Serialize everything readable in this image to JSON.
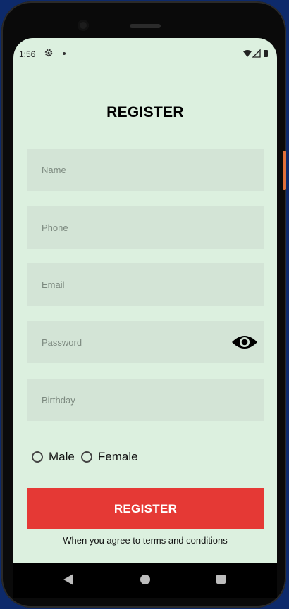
{
  "status_bar": {
    "time": "1:56",
    "icons": [
      "gear-icon",
      "notification-dot-icon",
      "wifi-icon",
      "signal-icon",
      "battery-icon"
    ]
  },
  "form": {
    "title": "REGISTER",
    "fields": [
      {
        "placeholder": "Name",
        "value": ""
      },
      {
        "placeholder": "Phone",
        "value": ""
      },
      {
        "placeholder": "Email",
        "value": ""
      },
      {
        "placeholder": "Password",
        "value": ""
      },
      {
        "placeholder": "Birthday",
        "value": ""
      }
    ],
    "gender_options": [
      "Male",
      "Female"
    ],
    "submit_label": "REGISTER",
    "terms_text": "When you agree to terms and conditions"
  },
  "nav_bar": {
    "icons": [
      "back-icon",
      "home-icon",
      "recents-icon"
    ]
  },
  "colors": {
    "screen_bg": "#dcf0df",
    "field_bg": "#d3e4d6",
    "accent": "#e53935"
  }
}
